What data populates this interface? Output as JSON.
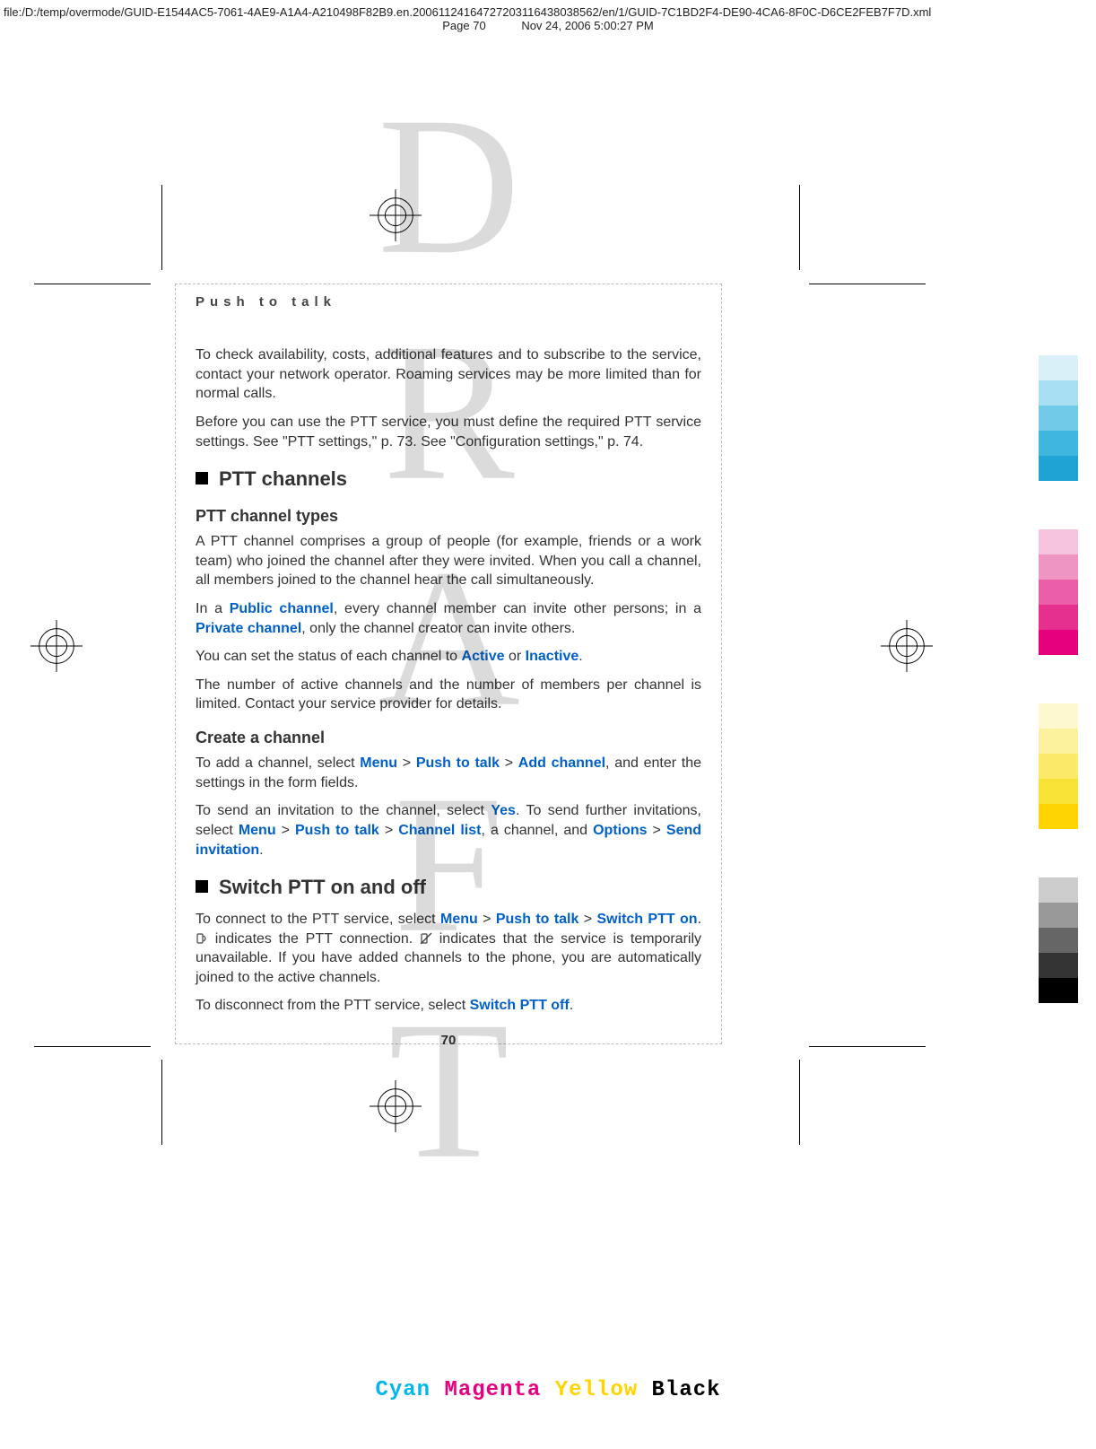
{
  "meta": {
    "filepath": "file:/D:/temp/overmode/GUID-E1544AC5-7061-4AE9-A1A4-A210498F82B9.en.20061124164727203116438038562/en/1/GUID-7C1BD2F4-DE90-4CA6-8F0C-D6CE2FEB7F7D.xml",
    "page_label": "Page 70",
    "datetime": "Nov 24, 2006 5:00:27 PM"
  },
  "doc": {
    "running_head": "Push to talk",
    "watermark": "DRAFT",
    "page_number": "70",
    "p1": "To check availability, costs, additional features and to subscribe to the service, contact your network operator. Roaming services may be more limited than for normal calls.",
    "p2": "Before you can use the PTT service, you must define the required PTT service settings. See \"PTT settings,\" p. 73. See \"Configuration settings,\" p. 74.",
    "h_channels": "PTT channels",
    "h_types": "PTT channel types",
    "p3": "A PTT channel comprises a group of people (for example, friends or a work team) who joined the channel after they were invited. When you call a channel, all members joined to the channel hear the call simultaneously.",
    "p4a": "In a ",
    "p4_link1": "Public channel",
    "p4b": ", every channel member can invite other persons; in a ",
    "p4_link2": "Private channel",
    "p4c": ", only the channel creator can invite others.",
    "p5a": "You can set the status of each channel to ",
    "p5_link1": "Active",
    "p5b": " or ",
    "p5_link2": "Inactive",
    "p5c": ".",
    "p6": "The number of active channels and the number of members per channel is limited. Contact your service provider for details.",
    "h_create": "Create a channel",
    "p7a": "To add a channel, select ",
    "p7_menu": "Menu",
    "p7_gt": " > ",
    "p7_ptt": "Push to talk",
    "p7_add": "Add channel",
    "p7b": ", and enter the settings in the form fields.",
    "p8a": "To send an invitation to the channel, select ",
    "p8_yes": "Yes",
    "p8b": ". To send further invitations, select ",
    "p8_cl": "Channel list",
    "p8c": ", a channel, and ",
    "p8_opt": "Options",
    "p8_si": "Send invitation",
    "p8d": ".",
    "h_switch": "Switch PTT on and off",
    "p9a": "To connect to the PTT service, select ",
    "p9_on": "Switch PTT on",
    "p9b": ". ",
    "p9c": " indicates the PTT connection. ",
    "p9d": " indicates that the service is temporarily unavailable. If you have added channels to the phone, you are automatically joined to the active channels.",
    "p10a": "To disconnect from the PTT service, select ",
    "p10_off": "Switch PTT off",
    "p10b": "."
  },
  "cmyk": {
    "c": "Cyan",
    "m": "Magenta",
    "y": "Yellow",
    "k": "Black"
  },
  "swatches": [
    "#d9f0f8",
    "#a8dff2",
    "#71cbe8",
    "#3fb6dd",
    "#1ea3d4",
    "gap",
    "#f5c3dd",
    "#ef95c4",
    "#ea5fa8",
    "#e6308f",
    "#e6007e",
    "gap",
    "#fdf8cf",
    "#fcf19c",
    "#fbea69",
    "#f9e236",
    "#ffd400",
    "gap",
    "#cccccc",
    "#999999",
    "#666666",
    "#333333",
    "#000000"
  ]
}
